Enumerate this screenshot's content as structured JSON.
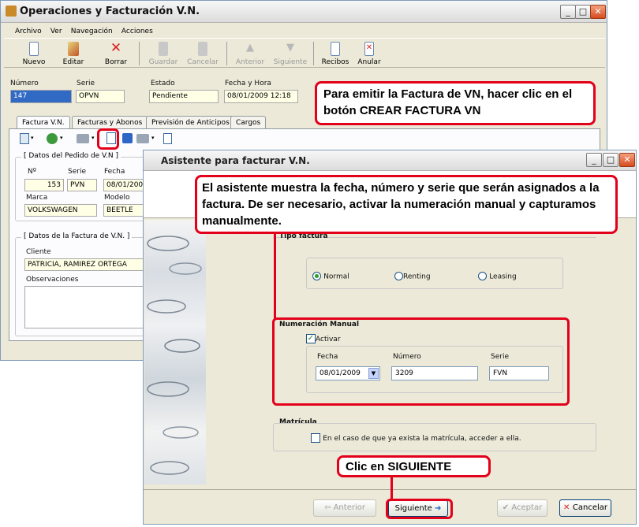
{
  "main_window": {
    "title": "Operaciones y Facturación V.N.",
    "menu": [
      "Archivo",
      "Ver",
      "Navegación",
      "Acciones"
    ],
    "toolbar": [
      {
        "label": "Nuevo",
        "icon": "new-document-icon",
        "enabled": true
      },
      {
        "label": "Editar",
        "icon": "edit-icon",
        "enabled": true
      },
      {
        "label": "Borrar",
        "icon": "delete-x-icon",
        "enabled": true
      },
      {
        "label": "Guardar",
        "icon": "save-icon",
        "enabled": false
      },
      {
        "label": "Cancelar",
        "icon": "cancel-icon",
        "enabled": false
      },
      {
        "label": "Anterior",
        "icon": "arrow-up-icon",
        "enabled": false
      },
      {
        "label": "Siguiente",
        "icon": "arrow-down-icon",
        "enabled": false
      },
      {
        "label": "Recibos",
        "icon": "receipt-icon",
        "enabled": true
      },
      {
        "label": "Anular",
        "icon": "void-icon",
        "enabled": true
      }
    ],
    "header_fields": {
      "numero_label": "Número",
      "numero_value": "147",
      "serie_label": "Serie",
      "serie_value": "OPVN",
      "estado_label": "Estado",
      "estado_value": "Pendiente",
      "fecha_label": "Fecha y Hora",
      "fecha_value": "08/01/2009 12:18"
    },
    "tabs": [
      "Factura V.N.",
      "Facturas y Abonos",
      "Previsión de Anticipos",
      "Cargos"
    ],
    "pedido_group": {
      "title": "[ Datos del Pedido de V.N ]",
      "n_label": "Nº",
      "n_value": "153",
      "serie_label": "Serie",
      "serie_value": "PVN",
      "fecha_label": "Fecha",
      "fecha_value": "08/01/200",
      "marca_label": "Marca",
      "marca_value": "VOLKSWAGEN",
      "modelo_label": "Modelo",
      "modelo_value": "BEETLE"
    },
    "factura_group": {
      "title": "[ Datos de la Factura de V.N. ]",
      "cliente_label": "Cliente",
      "cliente_value": "PATRICIA, RAMIREZ ORTEGA",
      "observaciones_label": "Observaciones"
    }
  },
  "callouts": {
    "top": "Para emitir la Factura de VN, hacer clic en el botón CREAR FACTURA VN",
    "middle": "El asistente muestra la fecha, número y serie que serán asignados a la factura. De ser necesario, activar la numeración manual y capturamos manualmente.",
    "bottom": "Clic en SIGUIENTE"
  },
  "wizard": {
    "title": "Asistente para facturar V.N.",
    "tipo_factura": {
      "title": "Tipo factura",
      "options": [
        "Normal",
        "Renting",
        "Leasing"
      ],
      "selected": "Normal"
    },
    "numeracion_manual": {
      "title": "Numeración Manual",
      "activar_label": "Activar",
      "activar_checked": true,
      "fecha_label": "Fecha",
      "fecha_value": "08/01/2009",
      "numero_label": "Número",
      "numero_value": "3209",
      "serie_label": "Serie",
      "serie_value": "FVN"
    },
    "matricula": {
      "title": "Matrícula",
      "checkbox_label": "En el caso de que ya exista la matrícula, acceder a ella."
    },
    "buttons": {
      "anterior": "Anterior",
      "siguiente": "Siguiente",
      "aceptar": "Aceptar",
      "cancelar": "Cancelar"
    }
  },
  "colors": {
    "accent_red": "#e2001a",
    "window_bg": "#ece9d8",
    "field_bg": "#ffffe6"
  }
}
